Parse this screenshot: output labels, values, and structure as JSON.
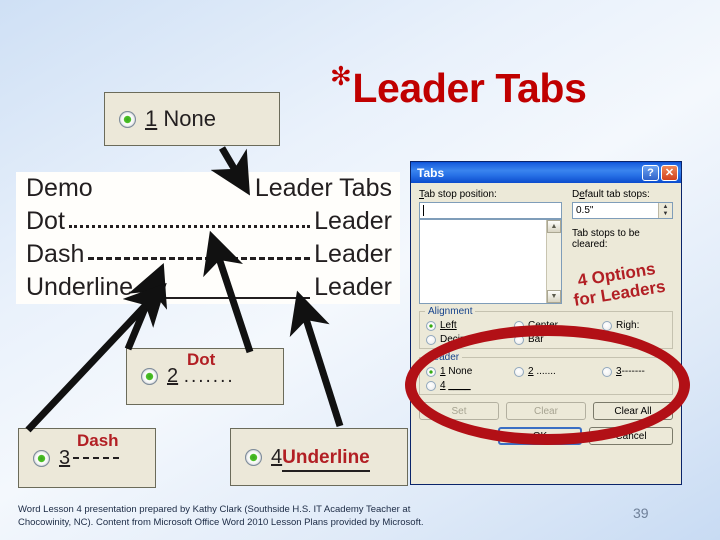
{
  "slide": {
    "title": "Leader Tabs",
    "title_bullet": "✻",
    "number": "39",
    "footer_line1": "Word Lesson 4 presentation prepared by Kathy Clark (Southside H.S. IT Academy Teacher at",
    "footer_line2": "Chocowinity, NC). Content from Microsoft Office Word 2010 Lesson Plans provided by Microsoft."
  },
  "colors": {
    "title_red": "#c00000",
    "annotation_red": "#b21f24",
    "ellipse_red": "#b21016",
    "dialog_face": "#ece9d8",
    "titlebar_blue": "#1b62e0"
  },
  "demo": {
    "rows": [
      {
        "label": "Demo",
        "leader": "none",
        "tail": "Leader Tabs"
      },
      {
        "label": "Dot",
        "leader": "dots",
        "tail": "Leader"
      },
      {
        "label": "Dash",
        "leader": "dashes",
        "tail": "Leader"
      },
      {
        "label": "Underline",
        "leader": "underline",
        "tail": "Leader"
      }
    ]
  },
  "callouts": {
    "none": {
      "number": "1",
      "label": "None",
      "sample": ""
    },
    "dot": {
      "number": "2",
      "label": "Dot",
      "sample": "......."
    },
    "dash": {
      "number": "3",
      "label": "Dash",
      "sample": "-------"
    },
    "underline": {
      "number": "4",
      "label": "Underline",
      "sample": "____"
    }
  },
  "dialog": {
    "title": "Tabs",
    "help_glyph": "?",
    "close_glyph": "✕",
    "tab_stop_position_label": "Tab stop position:",
    "tab_stop_position_value": "",
    "default_tab_stops_label": "Default tab stops:",
    "default_tab_stops_value": "0.5\"",
    "tab_stops_to_be_cleared_label": "Tab stops to be cleared:",
    "alignment": {
      "legend": "Alignment",
      "options": [
        {
          "label": "Left",
          "selected": true
        },
        {
          "label": "Center",
          "selected": false
        },
        {
          "label": "Righ:",
          "selected": false
        },
        {
          "label": "Decimal",
          "selected": false
        },
        {
          "label": "Bar",
          "selected": false
        }
      ]
    },
    "leader": {
      "legend": "Leader",
      "options": [
        {
          "number": "1",
          "label": "None",
          "selected": true
        },
        {
          "number": "2",
          "label": ".......",
          "selected": false
        },
        {
          "number": "3",
          "label": "-------",
          "selected": false
        },
        {
          "number": "4",
          "label": "____",
          "selected": false
        }
      ]
    },
    "buttons": {
      "set": "Set",
      "clear": "Clear",
      "clear_all": "Clear All",
      "ok": "OK",
      "cancel": "Cancel"
    }
  },
  "annotations": {
    "options_line1": "4 Options",
    "options_line2": "for Leaders"
  }
}
